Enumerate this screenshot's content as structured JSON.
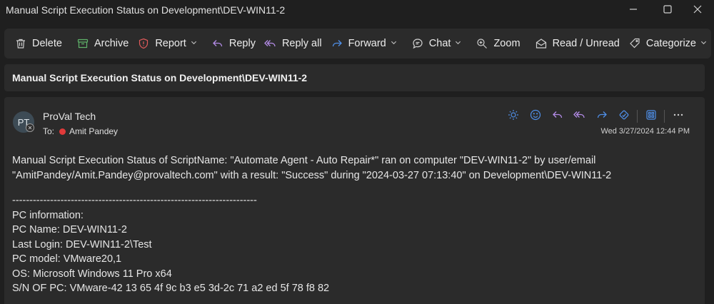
{
  "window": {
    "title": "Manual Script Execution Status on Development\\DEV-WIN11-2"
  },
  "toolbar": {
    "buttons": [
      {
        "label": "Delete",
        "icon": "trash-icon"
      },
      {
        "label": "Archive",
        "icon": "archive-icon"
      },
      {
        "label": "Report",
        "icon": "report-shield-icon",
        "dropdown": true
      },
      {
        "label": "Reply",
        "icon": "reply-icon"
      },
      {
        "label": "Reply all",
        "icon": "reply-all-icon"
      },
      {
        "label": "Forward",
        "icon": "forward-icon",
        "dropdown": true
      },
      {
        "label": "Chat",
        "icon": "chat-icon",
        "dropdown": true
      },
      {
        "label": "Zoom",
        "icon": "zoom-icon"
      },
      {
        "label": "Read / Unread",
        "icon": "envelope-open-icon"
      },
      {
        "label": "Categorize",
        "icon": "tag-icon",
        "dropdown": true
      }
    ]
  },
  "subject": "Manual Script Execution Status on Development\\DEV-WIN11-2",
  "message": {
    "avatar_initials": "PT",
    "sender": "ProVal Tech",
    "to_label": "To:",
    "recipient": "Amit Pandey",
    "datetime": "Wed 3/27/2024 12:44 PM",
    "body_lines": [
      "Manual Script Execution Status of ScriptName: \"Automate Agent - Auto Repair*\" ran on computer \"DEV-WIN11-2\" by user/email",
      "\"AmitPandey/Amit.Pandey@provaltech.com\" with a result: \"Success\" during \"2024-03-27 07:13:40\" on Development\\DEV-WIN11-2"
    ],
    "divider": "-----------------------------------------------------------------------",
    "pc_info": [
      "PC information:",
      "PC Name: DEV-WIN11-2",
      "Last Login: DEV-WIN11-2\\Test",
      "PC model: VMware20,1",
      "OS: Microsoft Windows 11 Pro x64",
      "S/N OF PC: VMware-42 13 65 4f 9c b3 e5 3d-2c 71 a2 ed 5f 78 f8 82"
    ]
  },
  "colors": {
    "background": "#1f1f1f",
    "panel": "#2b2b2b",
    "accent_blue": "#4f8fe8",
    "delete_gray": "#cfcfcf",
    "archive_green": "#5fb36a",
    "report_red": "#e05a5a",
    "reply_purple": "#b48ce8",
    "recipient_dot": "#e03a3a"
  }
}
